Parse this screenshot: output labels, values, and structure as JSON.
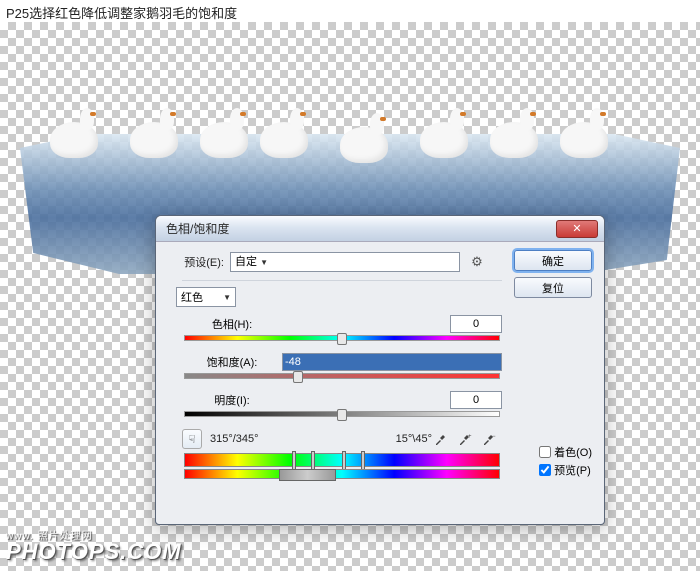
{
  "caption": "P25选择红色降低调整家鹅羽毛的饱和度",
  "watermark": {
    "small": "www.   照片处理网",
    "big": "PHOTOPS.COM"
  },
  "dialog": {
    "title": "色相/饱和度",
    "close": "✕",
    "preset_label": "预设(E):",
    "preset_value": "自定",
    "channel_value": "红色",
    "ok": "确定",
    "cancel": "复位",
    "hue_label": "色相(H):",
    "hue_value": "0",
    "sat_label": "饱和度(A):",
    "sat_value": "-48",
    "light_label": "明度(I):",
    "light_value": "0",
    "deg_left": "315°/345°",
    "deg_right": "15°\\45°",
    "colorize_label": "着色(O)",
    "preview_label": "预览(P)",
    "hand_icon": "☟"
  }
}
